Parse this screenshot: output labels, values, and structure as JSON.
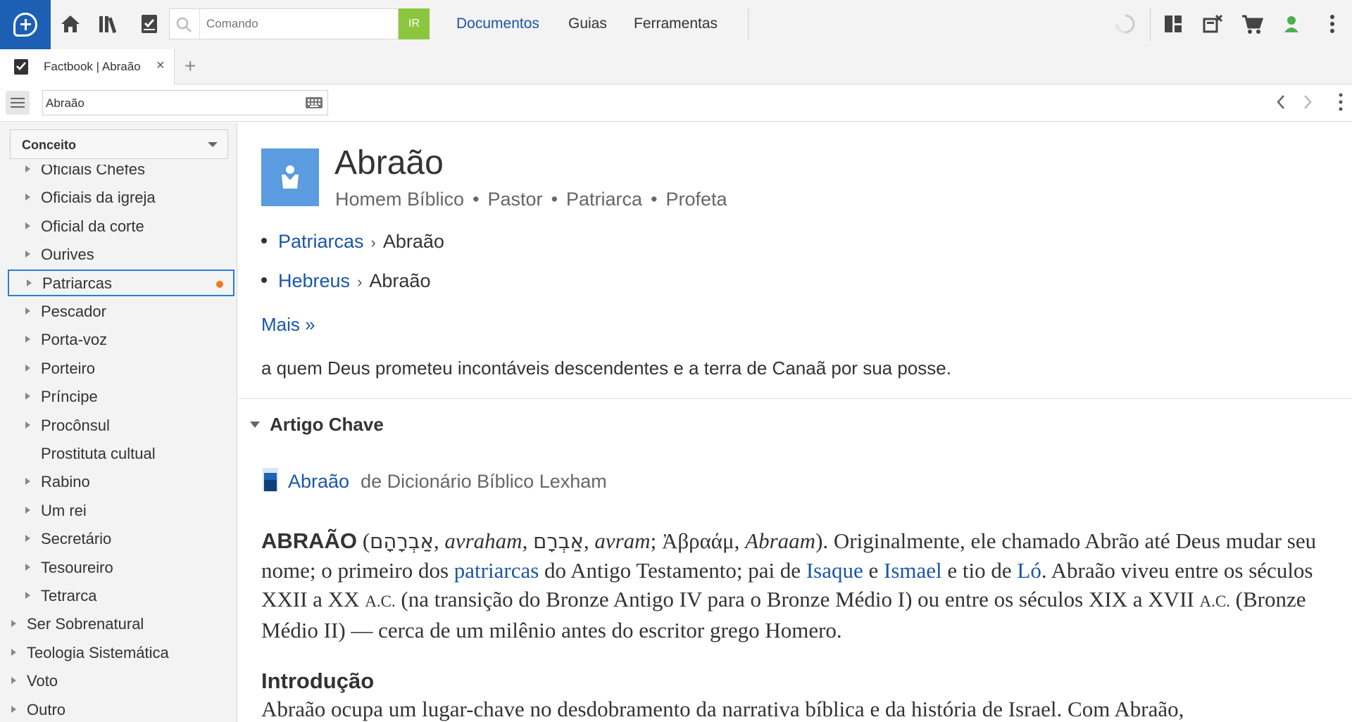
{
  "toolbar": {
    "search_placeholder": "Comando",
    "go_label": "IR",
    "menu": [
      "Documentos",
      "Guias",
      "Ferramentas"
    ]
  },
  "tab": {
    "title": "Factbook | Abraão",
    "close": "×",
    "add": "+"
  },
  "address": {
    "value": "Abraão"
  },
  "sidebar": {
    "select_label": "Conceito",
    "items": [
      {
        "label": "Oficiais Chefes",
        "indent": 1,
        "expandable": true
      },
      {
        "label": "Oficiais da igreja",
        "indent": 1,
        "expandable": true
      },
      {
        "label": "Oficial da corte",
        "indent": 1,
        "expandable": true
      },
      {
        "label": "Ourives",
        "indent": 1,
        "expandable": true
      },
      {
        "label": "Patriarcas",
        "indent": 1,
        "expandable": true,
        "selected": true
      },
      {
        "label": "Pescador",
        "indent": 1,
        "expandable": true
      },
      {
        "label": "Porta-voz",
        "indent": 1,
        "expandable": true
      },
      {
        "label": "Porteiro",
        "indent": 1,
        "expandable": true
      },
      {
        "label": "Príncipe",
        "indent": 1,
        "expandable": true
      },
      {
        "label": "Procônsul",
        "indent": 1,
        "expandable": true
      },
      {
        "label": "Prostituta cultual",
        "indent": 1,
        "expandable": false
      },
      {
        "label": "Rabino",
        "indent": 1,
        "expandable": true
      },
      {
        "label": "Um rei",
        "indent": 1,
        "expandable": true
      },
      {
        "label": "Secretário",
        "indent": 1,
        "expandable": true
      },
      {
        "label": "Tesoureiro",
        "indent": 1,
        "expandable": true
      },
      {
        "label": "Tetrarca",
        "indent": 1,
        "expandable": true
      },
      {
        "label": "Ser Sobrenatural",
        "indent": 0,
        "expandable": true
      },
      {
        "label": "Teologia Sistemática",
        "indent": 0,
        "expandable": true
      },
      {
        "label": "Voto",
        "indent": 0,
        "expandable": true
      },
      {
        "label": "Outro",
        "indent": 0,
        "expandable": true
      }
    ]
  },
  "content": {
    "title": "Abraão",
    "roles": [
      "Homem Bíblico",
      "Pastor",
      "Patriarca",
      "Profeta"
    ],
    "breadcrumbs": [
      {
        "link": "Patriarcas",
        "current": "Abraão"
      },
      {
        "link": "Hebreus",
        "current": "Abraão"
      }
    ],
    "more": "Mais »",
    "summary": "a quem Deus prometeu incontáveis descendentes e a terra de Canaã por sua posse.",
    "section_title": "Artigo Chave",
    "article_ref": {
      "link": "Abraão",
      "from": "de Dicionário Bíblico Lexham"
    },
    "article": {
      "headword": "ABRAÃO",
      "p1": "(",
      "heb1": "אַבְרָהָם",
      "t1": ", ",
      "tr1": "avraham",
      "t2": ", ",
      "heb2": "אַבְרָם",
      "t3": ", ",
      "tr2": "avram",
      "t4": "; ",
      "greek": "Ἀβραάμ",
      "t5": ", ",
      "tr3": "Abraam",
      "t6": "). Originalmente, ele chamado Abrão até Deus mudar seu nome; o primeiro dos ",
      "l1": "patriarcas",
      "t7": " do Antigo Testamento; pai de ",
      "l2": "Isaque",
      "t8": " e ",
      "l3": "Ismael",
      "t9": " e tio de ",
      "l4": "Ló",
      "t10": ". Abraão viveu entre os séculos XXII a XX ",
      "ac1": "A.C.",
      "t11": " (na transição do Bronze Antigo IV para o Bronze Médio I) ou entre os séculos XIX a XVII ",
      "ac2": "A.C.",
      "t12": " (Bronze Médio II) — cerca de um milênio antes do escritor grego Homero."
    },
    "intro_title": "Introdução",
    "intro_text": "Abraão ocupa um lugar-chave no desdobramento da narrativa bíblica e da história de Israel. Com Abraão,"
  },
  "colors": {
    "brand": "#1d5fb3",
    "link": "#1a56a8",
    "go": "#8cc63f",
    "selection": "#2b7fd4",
    "dot": "#f07b1d",
    "avatar": "#5b9be0",
    "status": "#4caf50"
  },
  "icons": [
    "logo-icon",
    "home-icon",
    "library-icon",
    "checklist-icon",
    "search-icon",
    "sync-icon",
    "layout-icon",
    "close-panels-icon",
    "cart-icon",
    "user-status-icon",
    "more-vertical-icon",
    "keyboard-icon",
    "hamburger-icon",
    "chevron-left-icon",
    "chevron-right-icon",
    "person-icon",
    "book-icon"
  ]
}
